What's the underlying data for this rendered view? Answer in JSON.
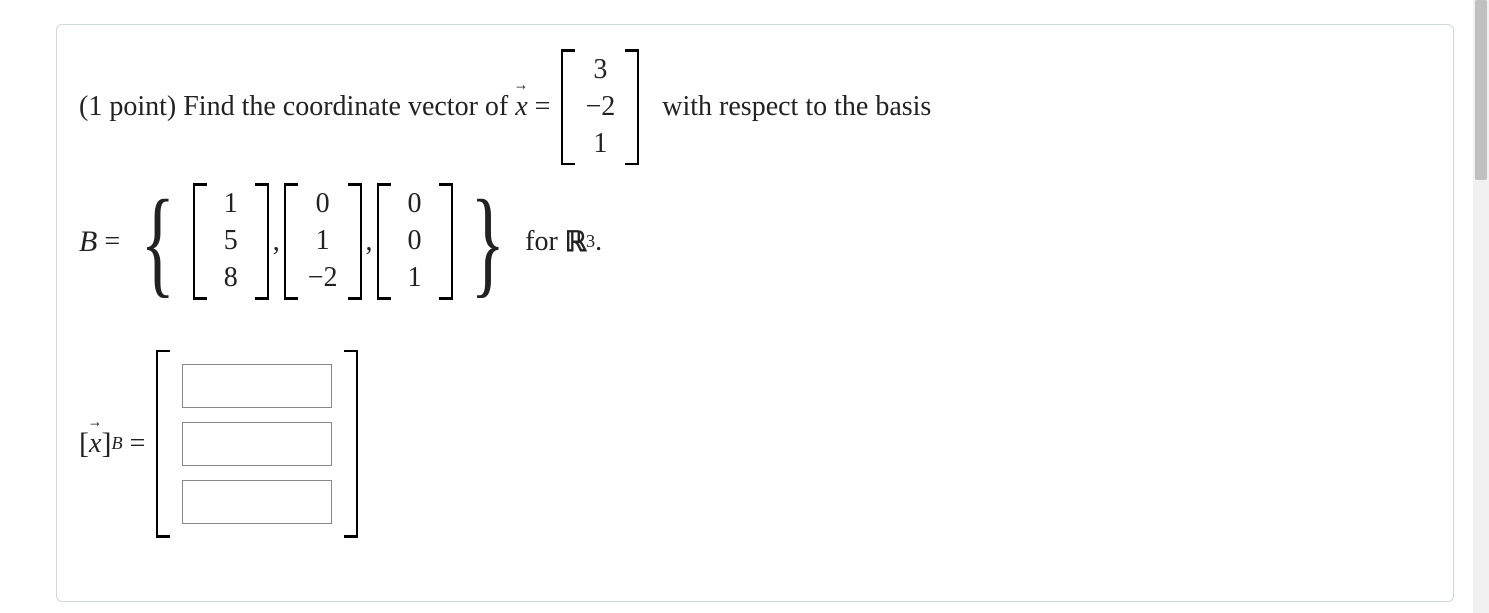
{
  "problem": {
    "points_label": "(1 point) ",
    "prompt_before": "Find the coordinate vector of ",
    "vector_symbol": "x",
    "equals": " = ",
    "x_vector": [
      "3",
      "−2",
      "1"
    ],
    "prompt_after": " with respect to the basis",
    "basis_label": "B",
    "basis_eq": " = ",
    "basis_vectors": [
      [
        "1",
        "5",
        "8"
      ],
      [
        "0",
        "1",
        "−2"
      ],
      [
        "0",
        "0",
        "1"
      ]
    ],
    "for_text": " for ",
    "space_R": "ℝ",
    "space_dim": "3",
    "period": ".",
    "answer_label_open": "[",
    "answer_label_vec": "x",
    "answer_label_close": "]",
    "answer_label_sub": "B",
    "answer_eq": " = ",
    "answer_inputs": [
      "",
      "",
      ""
    ],
    "comma": ","
  }
}
